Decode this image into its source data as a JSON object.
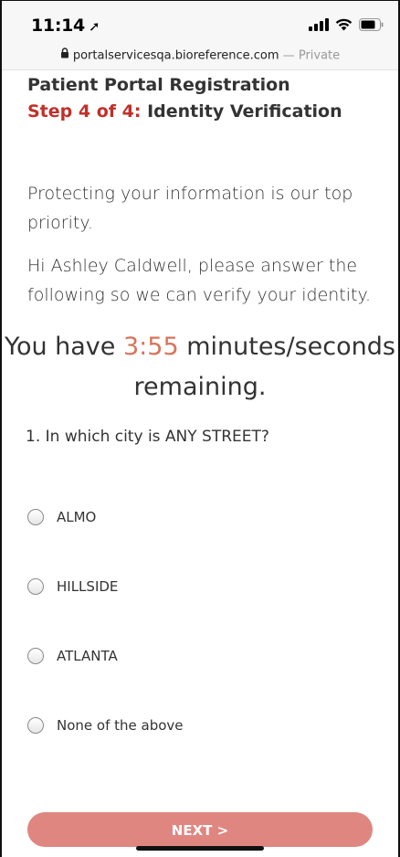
{
  "status_bar": {
    "time": "11:14",
    "location_icon": "location-arrow-icon",
    "signal_icon": "cellular-signal-icon",
    "wifi_icon": "wifi-icon",
    "battery_icon": "battery-icon"
  },
  "url_bar": {
    "domain": "portalservicesqa.bioreference.com",
    "separator": " — ",
    "mode": "Private",
    "lock_icon": "lock-icon"
  },
  "header": {
    "title": "Patient Portal Registration",
    "step_label": "Step 4 of 4:",
    "step_title": " Identity Verification"
  },
  "intro": {
    "paragraph1": "Protecting your information is our top priority.",
    "paragraph2": "Hi Ashley Caldwell, please answer the following so we can verify your identity."
  },
  "timer": {
    "prefix": "You have ",
    "countdown": "3:55",
    "suffix": " minutes/seconds remaining.",
    "countdown_color": "#d9735a"
  },
  "question": {
    "text": "1. In which city is ANY STREET?",
    "options": [
      {
        "label": "ALMO",
        "selected": false
      },
      {
        "label": "HILLSIDE",
        "selected": false
      },
      {
        "label": "ATLANTA",
        "selected": false
      },
      {
        "label": "None of the above",
        "selected": false
      }
    ]
  },
  "next_button": {
    "label": "NEXT >",
    "color": "#e08681"
  },
  "colors": {
    "step_accent": "#c0302a"
  }
}
